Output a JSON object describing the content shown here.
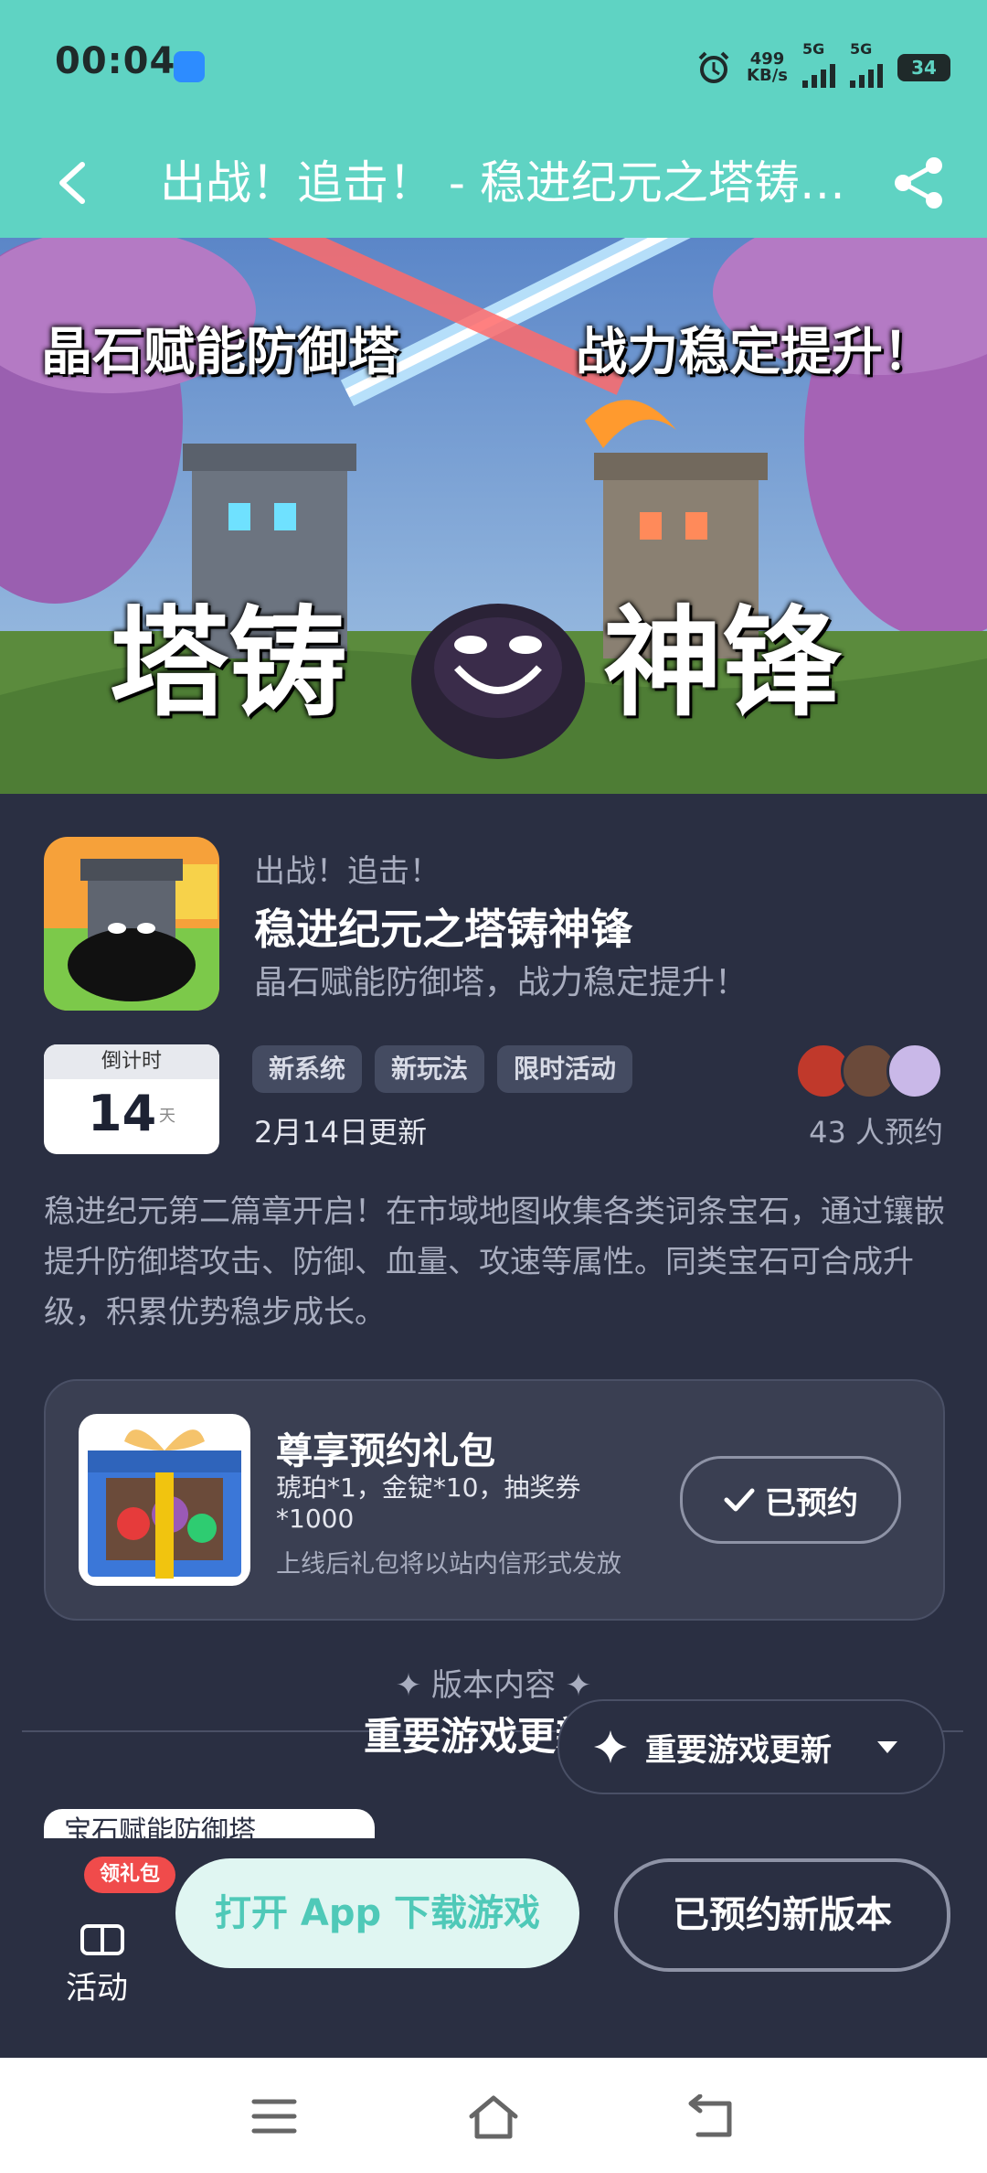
{
  "status": {
    "time": "00:04",
    "speed_value": "499",
    "speed_unit": "KB/s",
    "net1": "5G",
    "net2": "5G",
    "battery": "34"
  },
  "nav": {
    "title": "出战！追击！ - 稳进纪元之塔铸神锋"
  },
  "banner": {
    "left_caption": "晶石赋能防御塔",
    "right_caption": "战力稳定提升！",
    "logo_text_left": "塔铸",
    "logo_text_right": "神锋"
  },
  "game": {
    "subtitle": "出战！追击！",
    "title": "稳进纪元之塔铸神锋",
    "slogan": "晶石赋能防御塔，战力稳定提升！"
  },
  "countdown": {
    "label": "倒计时",
    "number": "14",
    "unit": "天"
  },
  "tags": [
    "新系统",
    "新玩法",
    "限时活动"
  ],
  "update_date": "2月14日更新",
  "reserve_count": "43 人预约",
  "description": "稳进纪元第二篇章开启！在市域地图收集各类词条宝石，通过镶嵌提升防御塔攻击、防御、血量、攻速等属性。同类宝石可合成升级，积累优势稳步成长。",
  "gift": {
    "title": "尊享预约礼包",
    "items": "琥珀*1，金锭*10，抽奖券*1000",
    "note": "上线后礼包将以站内信形式发放",
    "button": "已预约"
  },
  "section": {
    "label": "✦ 版本内容 ✦",
    "title": "重要游戏更新",
    "pill": "重要游戏更新",
    "chip": "宝石赋能防御塔"
  },
  "bottom": {
    "activity_label": "活动",
    "gift_badge": "领礼包",
    "open_app": "打开 App 下载游戏",
    "reserved_new": "已预约新版本"
  }
}
